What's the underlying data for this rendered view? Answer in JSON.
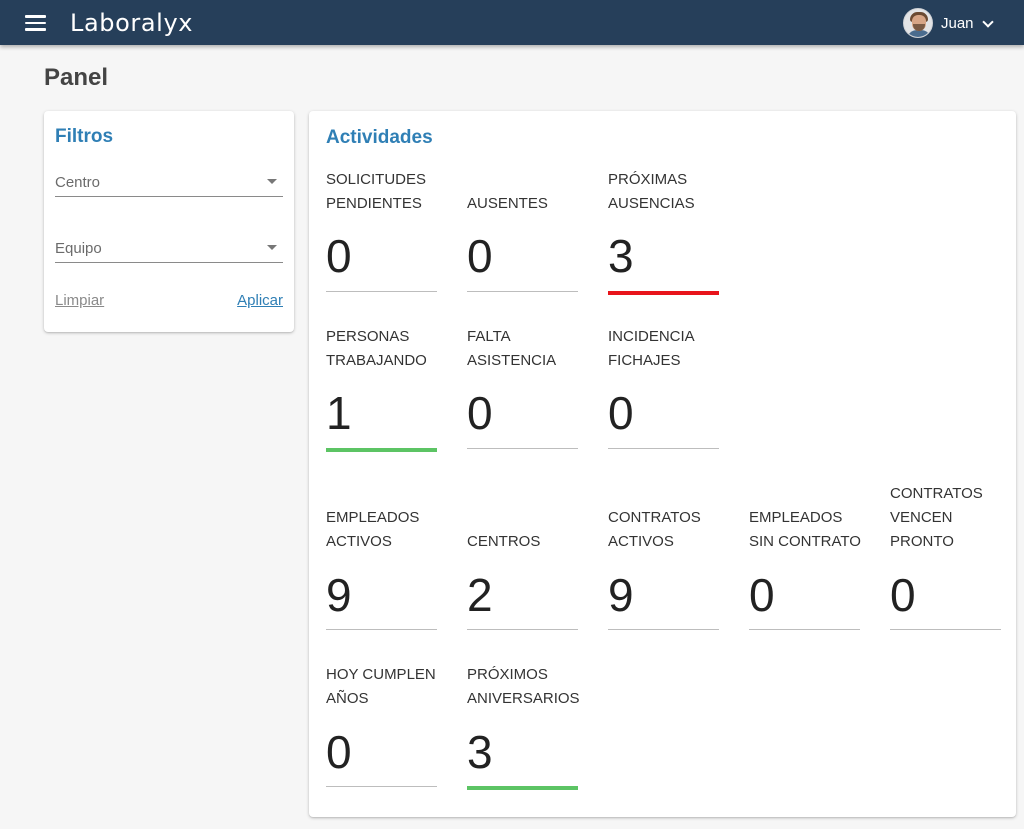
{
  "header": {
    "brand": "Laboralyx",
    "user_name": "Juan",
    "colors": {
      "background": "#263f5a"
    }
  },
  "page": {
    "title": "Panel"
  },
  "filters": {
    "title": "Filtros",
    "centro_label": "Centro",
    "equipo_label": "Equipo",
    "clear_label": "Limpiar",
    "apply_label": "Aplicar"
  },
  "activities": {
    "title": "Actividades",
    "stats": [
      {
        "label": "SOLICITUDES PENDIENTES",
        "value": "0",
        "status": "none"
      },
      {
        "label": "AUSENTES",
        "value": "0",
        "status": "none"
      },
      {
        "label": "PRÓXIMAS AUSENCIAS",
        "value": "3",
        "status": "red"
      },
      {
        "label": "PERSONAS TRABAJANDO",
        "value": "1",
        "status": "green"
      },
      {
        "label": "FALTA ASISTENCIA",
        "value": "0",
        "status": "none"
      },
      {
        "label": "INCIDENCIA FICHAJES",
        "value": "0",
        "status": "none"
      },
      {
        "label": "EMPLEADOS ACTIVOS",
        "value": "9",
        "status": "none"
      },
      {
        "label": "CENTROS",
        "value": "2",
        "status": "none"
      },
      {
        "label": "CONTRATOS ACTIVOS",
        "value": "9",
        "status": "none"
      },
      {
        "label": "EMPLEADOS SIN CONTRATO",
        "value": "0",
        "status": "none"
      },
      {
        "label": "CONTRATOS VENCEN PRONTO",
        "value": "0",
        "status": "none"
      },
      {
        "label": "HOY CUMPLEN AÑOS",
        "value": "0",
        "status": "none"
      },
      {
        "label": "PRÓXIMOS ANIVERSARIOS",
        "value": "3",
        "status": "green"
      }
    ],
    "colors": {
      "red": "#e8141b",
      "green": "#5cc464",
      "title": "#2f7fb5"
    }
  }
}
